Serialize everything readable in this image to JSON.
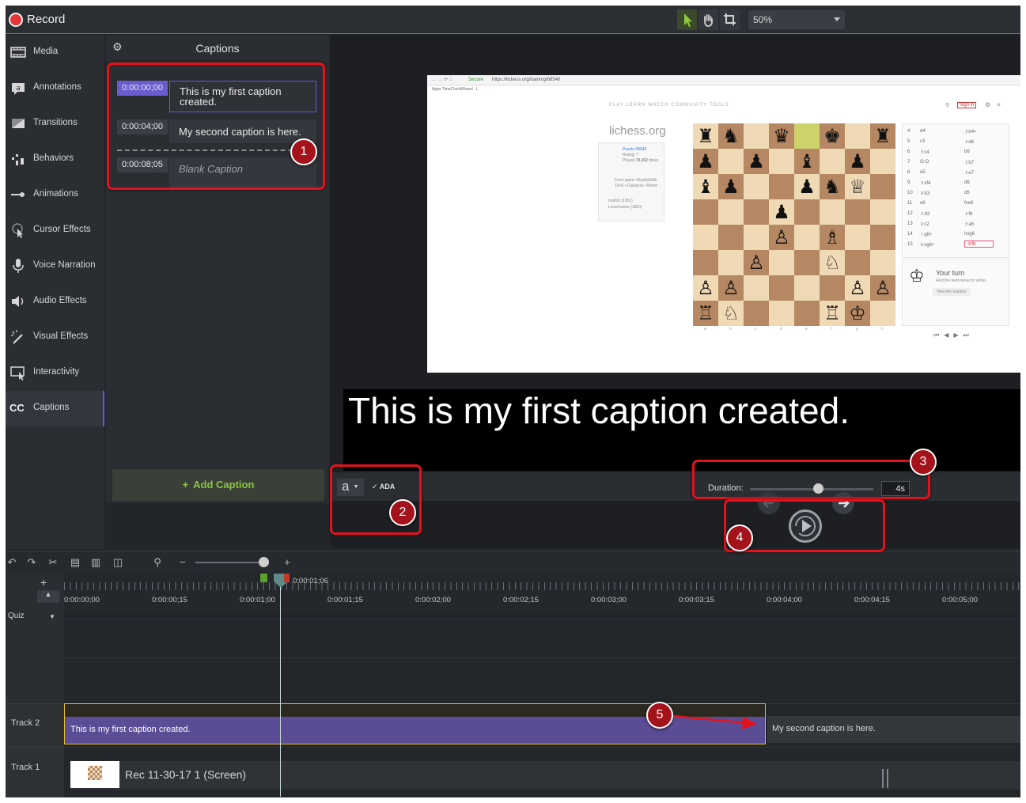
{
  "topbar": {
    "record_label": "Record",
    "zoom_value": "50%"
  },
  "sidebar": {
    "items": [
      {
        "label": "Media",
        "icon": "film-icon"
      },
      {
        "label": "Annotations",
        "icon": "annotation-icon"
      },
      {
        "label": "Transitions",
        "icon": "transition-icon"
      },
      {
        "label": "Behaviors",
        "icon": "behavior-icon"
      },
      {
        "label": "Animations",
        "icon": "animation-icon"
      },
      {
        "label": "Cursor Effects",
        "icon": "cursor-icon"
      },
      {
        "label": "Voice Narration",
        "icon": "microphone-icon"
      },
      {
        "label": "Audio Effects",
        "icon": "speaker-icon"
      },
      {
        "label": "Visual Effects",
        "icon": "magic-wand-icon"
      },
      {
        "label": "Interactivity",
        "icon": "interactive-icon"
      },
      {
        "label": "Captions",
        "icon": "cc-icon",
        "badge": "CC"
      }
    ]
  },
  "captions_panel": {
    "title": "Captions",
    "captions": [
      {
        "time": "0:00:00;00",
        "text": "This is my first caption created."
      },
      {
        "time": "0:00:04;00",
        "text": "My second caption is here."
      },
      {
        "time": "0:00:08;05",
        "text": "Blank Caption"
      }
    ],
    "add_label": "Add Caption"
  },
  "preview": {
    "browser_url": "https://lichess.org/training/68540",
    "browser_secure": "Secure",
    "bookmarks": "Apps   TimeClockWizard - L",
    "site_nav": "PLAY   LEARN   WATCH   COMMUNITY   TOOLS",
    "site_logo": "lichess.org",
    "sign_in": "Sign in",
    "puzzle_title": "Puzzle 68540",
    "puzzle_rating": "Rating: ?",
    "puzzle_played_prefix": "Played",
    "puzzle_played_count": "79,262",
    "puzzle_played_suffix": "times",
    "from_game": "From game #6ya5xEMh",
    "game_type": "10+0 • Classical • Rated",
    "player1": "mufion (1951)",
    "player2": "Levschanov (1860)",
    "moves": [
      [
        "4",
        "d4",
        "♗b4+"
      ],
      [
        "5",
        "c3",
        "♗d6"
      ],
      [
        "6",
        "♗c4",
        "b6"
      ],
      [
        "7",
        "O-O",
        "♗b7"
      ],
      [
        "8",
        "e5",
        "♗e7"
      ],
      [
        "9",
        "♗xf4",
        "d6"
      ],
      [
        "10",
        "♕b3",
        "d5"
      ],
      [
        "11",
        "e6",
        "fxe6"
      ],
      [
        "12",
        "♗d3",
        "♗f6"
      ],
      [
        "13",
        "♕c2",
        "♗a6"
      ],
      [
        "14",
        "♘g6+",
        "hxg6"
      ],
      [
        "15",
        "♕xg6+",
        "♔f8"
      ]
    ],
    "your_turn_title": "Your turn",
    "your_turn_sub": "Find the best move for white.",
    "view_solution": "View the solution",
    "files": [
      "a",
      "b",
      "c",
      "d",
      "e",
      "f",
      "g",
      "h"
    ],
    "ranks": [
      "8",
      "7",
      "6",
      "5",
      "4",
      "3",
      "2",
      "1"
    ],
    "board": [
      [
        "♜",
        "♞",
        "",
        "♛",
        "",
        "♚",
        "",
        "♜"
      ],
      [
        "♟",
        "",
        "♟",
        "",
        "♝",
        "",
        "♟",
        ""
      ],
      [
        "♝",
        "♟",
        "",
        "",
        "♟",
        "♞",
        "♕",
        ""
      ],
      [
        "",
        "",
        "",
        "♟",
        "",
        "",
        "",
        ""
      ],
      [
        "",
        "",
        "",
        "♙",
        "",
        "♗",
        "",
        ""
      ],
      [
        "",
        "",
        "♙",
        "",
        "",
        "♘",
        "",
        ""
      ],
      [
        "♙",
        "♙",
        "",
        "",
        "",
        "",
        "♙",
        "♙"
      ],
      [
        "♖",
        "♘",
        "",
        "",
        "",
        "♖",
        "♔",
        ""
      ]
    ]
  },
  "caption_preview_text": "This is my first caption created.",
  "properties": {
    "font_glyph": "a",
    "ada_label": "ADA",
    "duration_label": "Duration:",
    "duration_value": "4s",
    "duration_slider_fraction": 0.55
  },
  "timeline": {
    "playhead_time": "0:00:01;06",
    "ruler_labels": [
      "0:00:00;00",
      "0:00:00;15",
      "0:00:01;00",
      "0:00:01;15",
      "0:00:02;00",
      "0:00:02;15",
      "0:00:03;00",
      "0:00:03;15",
      "0:00:04;00",
      "0:00:04;15",
      "0:00:05;00"
    ],
    "quiz_label": "Quiz",
    "track2_label": "Track 2",
    "track1_label": "Track 1",
    "clip1_text": "This is my first caption created.",
    "clip2_text": "My second caption is here.",
    "media_clip_name": "Rec 11-30-17 1 (Screen)"
  },
  "annotations": [
    "1",
    "2",
    "3",
    "4",
    "5"
  ],
  "colors": {
    "accent_purple": "#6a5bd0",
    "accent_green": "#8cc63f",
    "callout_red": "#e3121b",
    "record_red": "#e5353b"
  }
}
